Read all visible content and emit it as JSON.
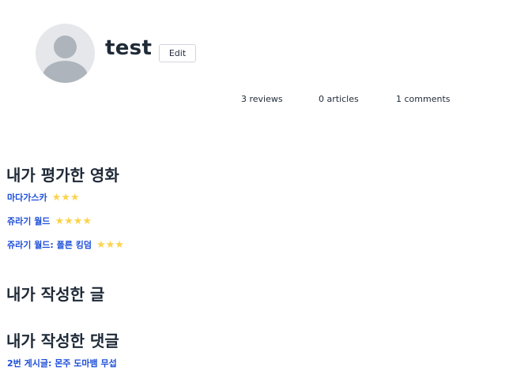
{
  "profile": {
    "username": "test",
    "edit_label": "Edit"
  },
  "stats": {
    "reviews": "3 reviews",
    "articles": "0 articles",
    "comments": "1 comments"
  },
  "rated_movies": {
    "title": "내가 평가한 영화",
    "items": [
      {
        "title": "마다가스카",
        "rating": 3,
        "stars": "★★★"
      },
      {
        "title": "쥬라기 월드",
        "rating": 4,
        "stars": "★★★★"
      },
      {
        "title": "쥬라기 월드: 폴른 킹덤",
        "rating": 3,
        "stars": "★★★"
      }
    ]
  },
  "articles": {
    "title": "내가 작성한 글"
  },
  "comments": {
    "title": "내가 작성한 댓글",
    "items": [
      {
        "text": "2번 게시글: 몬주 도마뱀 무섭"
      }
    ]
  },
  "colors": {
    "link": "#1d4ed8",
    "star": "#fcd34d",
    "heading": "#1f2a37"
  }
}
